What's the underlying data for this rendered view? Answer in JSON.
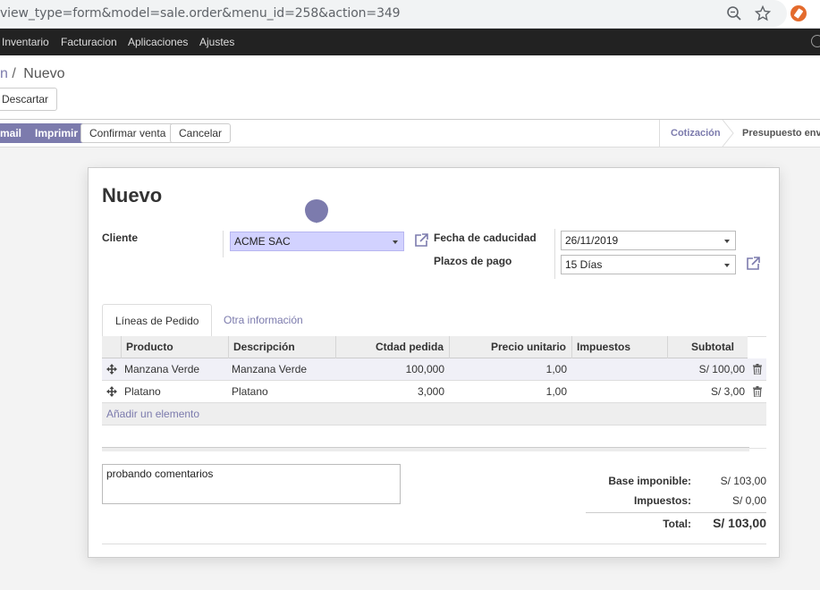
{
  "browser": {
    "url": "view_type=form&model=sale.order&menu_id=258&action=349",
    "icons": [
      "zoom-icon",
      "star-icon",
      "extension-icon"
    ]
  },
  "topnav": {
    "items": [
      "Inventario",
      "Facturacion",
      "Aplicaciones",
      "Ajustes"
    ]
  },
  "breadcrumb": {
    "parent_fragment": "n",
    "separator": "/",
    "current": "Nuevo"
  },
  "control": {
    "discard_label": "Descartar"
  },
  "statusbar": {
    "email_label": "mail",
    "print_label": "Imprimir",
    "confirm_label": "Confirmar venta",
    "cancel_label": "Cancelar",
    "stages": [
      "Cotización",
      "Presupuesto envia"
    ]
  },
  "form": {
    "title": "Nuevo",
    "customer_label": "Cliente",
    "customer_value": "ACME SAC",
    "expiration_label": "Fecha de caducidad",
    "expiration_value": "26/11/2019",
    "payment_terms_label": "Plazos de pago",
    "payment_terms_value": "15 Días"
  },
  "tabs": [
    "Líneas de Pedido",
    "Otra información"
  ],
  "table": {
    "headers": [
      "Producto",
      "Descripción",
      "Ctdad pedida",
      "Precio unitario",
      "Impuestos",
      "Subtotal"
    ],
    "rows": [
      {
        "product": "Manzana Verde",
        "description": "Manzana Verde",
        "qty": "100,000",
        "price": "1,00",
        "taxes": "",
        "subtotal": "S/ 100,00"
      },
      {
        "product": "Platano",
        "description": "Platano",
        "qty": "3,000",
        "price": "1,00",
        "taxes": "",
        "subtotal": "S/ 3,00"
      }
    ],
    "add_line": "Añadir un elemento"
  },
  "notes": "probando comentarios",
  "totals": {
    "base_label": "Base imponible:",
    "base_value": "S/ 103,00",
    "taxes_label": "Impuestos:",
    "taxes_value": "S/ 0,00",
    "total_label": "Total:",
    "total_value": "S/ 103,00"
  },
  "colors": {
    "accent": "#7c7bad",
    "highlight_field": "#d2d2ff",
    "navbar": "#222222"
  }
}
